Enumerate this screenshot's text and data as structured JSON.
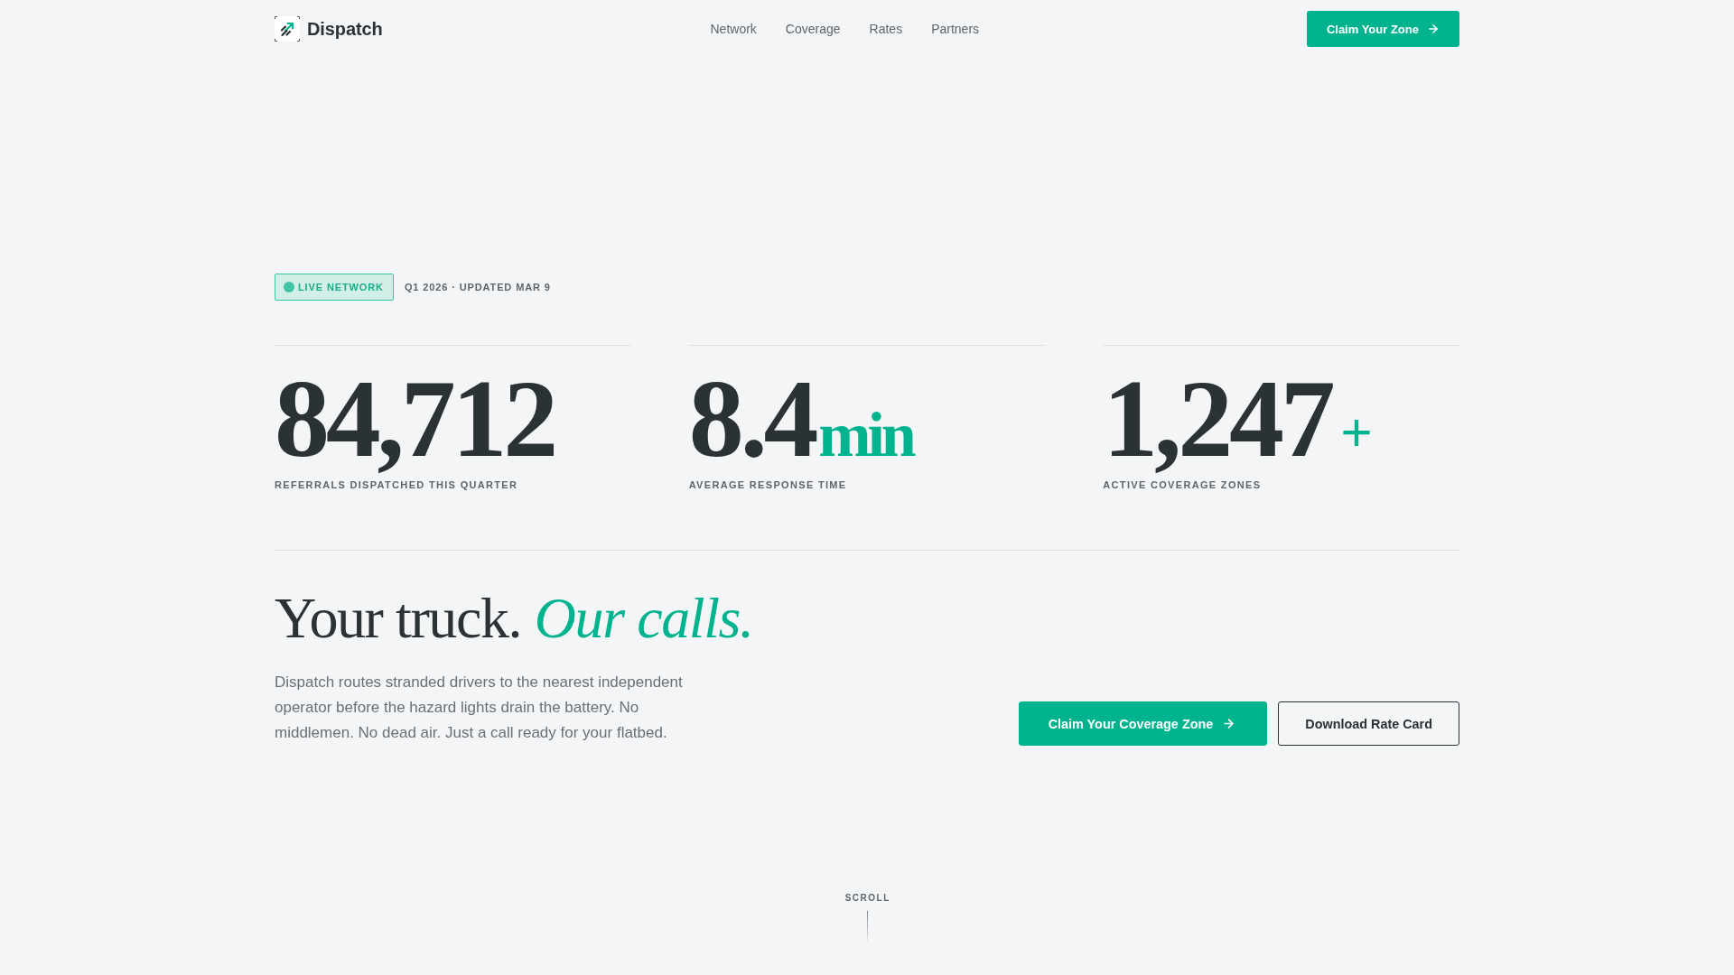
{
  "header": {
    "brand": "Dispatch",
    "nav": [
      {
        "label": "Network"
      },
      {
        "label": "Coverage"
      },
      {
        "label": "Rates"
      },
      {
        "label": "Partners"
      }
    ],
    "cta": {
      "label": "Claim Your Zone"
    }
  },
  "status": {
    "badge": "LIVE NETWORK",
    "meta": "Q1 2026 · UPDATED MAR 9"
  },
  "stats": [
    {
      "value": "84,712",
      "label": "REFERRALS DISPATCHED THIS QUARTER"
    },
    {
      "value": "8.4",
      "suffix": {
        "kind": "unit",
        "text": "min"
      },
      "label": "AVERAGE RESPONSE TIME"
    },
    {
      "value": "1,247",
      "suffix": {
        "kind": "plus",
        "text": "+"
      },
      "label": "ACTIVE COVERAGE ZONES"
    }
  ],
  "intro": {
    "headline": "Your truck. *Our calls.*",
    "body": "Dispatch routes stranded drivers to the nearest independent operator before the hazard lights drain the battery. No middlemen. No dead air. Just a call ready for your flatbed.",
    "actions": [
      {
        "label": "Claim Your Coverage Zone",
        "kind": "primary"
      },
      {
        "label": "Download Rate Card",
        "kind": "secondary"
      }
    ]
  },
  "scroll_hint": {
    "label": "SCROLL"
  }
}
